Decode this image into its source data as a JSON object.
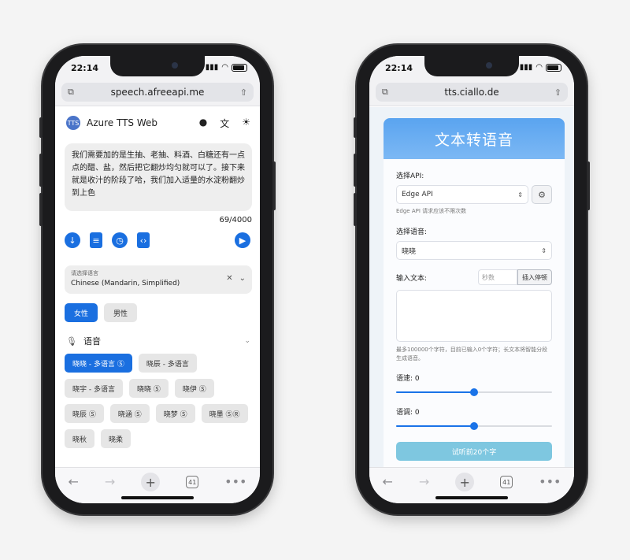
{
  "left": {
    "status": {
      "time": "22:14"
    },
    "url": "speech.afreeapi.me",
    "header": {
      "logo": "TTS",
      "title": "Azure TTS Web"
    },
    "text": "我们需要加的是生抽、老抽、料酒、白糖还有一点点的醋、盐，然后把它翻炒均匀就可以了。接下来就是收汁的阶段了哈，我们加入适量的水淀粉翻炒到上色",
    "char_count": "69/4000",
    "language": {
      "caption": "请选择语言",
      "value": "Chinese (Mandarin, Simplified)"
    },
    "gender": {
      "female": "女性",
      "male": "男性"
    },
    "voice_header": "语音",
    "voices": [
      "晓晓 - 多语言 Ⓢ",
      "晓辰 - 多语言",
      "晓宇 - 多语言",
      "晓晓 Ⓢ",
      "晓伊 Ⓢ",
      "晓辰 Ⓢ",
      "晓涵 Ⓢ",
      "晓梦 Ⓢ",
      "晓墨 ⓈⓇ",
      "晓秋",
      "晓柔"
    ],
    "tabs_count": "41"
  },
  "right": {
    "status": {
      "time": "22:14"
    },
    "url": "tts.ciallo.de",
    "hero_title": "文本转语音",
    "api_label": "选择API:",
    "api_value": "Edge API",
    "api_hint": "Edge API 请求应该不限次数",
    "voice_label": "选择语音:",
    "voice_value": "晓晓",
    "text_label": "输入文本:",
    "seconds_placeholder": "秒数",
    "insert_pause": "插入停顿",
    "note": "最多100000个字符，目前已输入0个字符；长文本将智能分段生成语音。",
    "speed_label": "语速: 0",
    "pitch_label": "语调: 0",
    "speed": 0,
    "pitch": 0,
    "preview_button": "试听前20个字",
    "tabs_count": "41"
  }
}
